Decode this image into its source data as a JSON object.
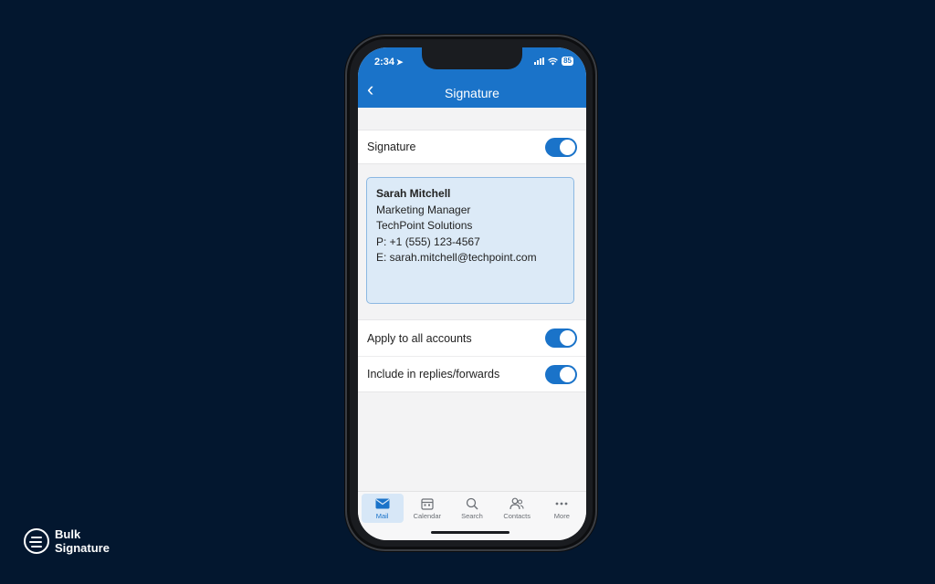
{
  "status": {
    "time": "2:34",
    "battery": "85"
  },
  "header": {
    "title": "Signature"
  },
  "signature_row": {
    "label": "Signature",
    "enabled": true
  },
  "signature": {
    "name": "Sarah Mitchell",
    "lines": [
      "Marketing Manager",
      "TechPoint Solutions",
      "P: +1 (555) 123-4567",
      "E: sarah.mitchell@techpoint.com"
    ]
  },
  "options": [
    {
      "label": "Apply to all accounts",
      "enabled": true
    },
    {
      "label": "Include in replies/forwards",
      "enabled": true
    }
  ],
  "tabs": [
    {
      "label": "Mail",
      "icon": "mail-icon",
      "active": true
    },
    {
      "label": "Calendar",
      "icon": "calendar-icon"
    },
    {
      "label": "Search",
      "icon": "search-icon"
    },
    {
      "label": "Contacts",
      "icon": "contacts-icon"
    },
    {
      "label": "More",
      "icon": "more-icon"
    }
  ],
  "brand": {
    "line1": "Bulk",
    "line2": "Signature"
  },
  "colors": {
    "accent": "#1a73c9",
    "background": "#03172f"
  }
}
